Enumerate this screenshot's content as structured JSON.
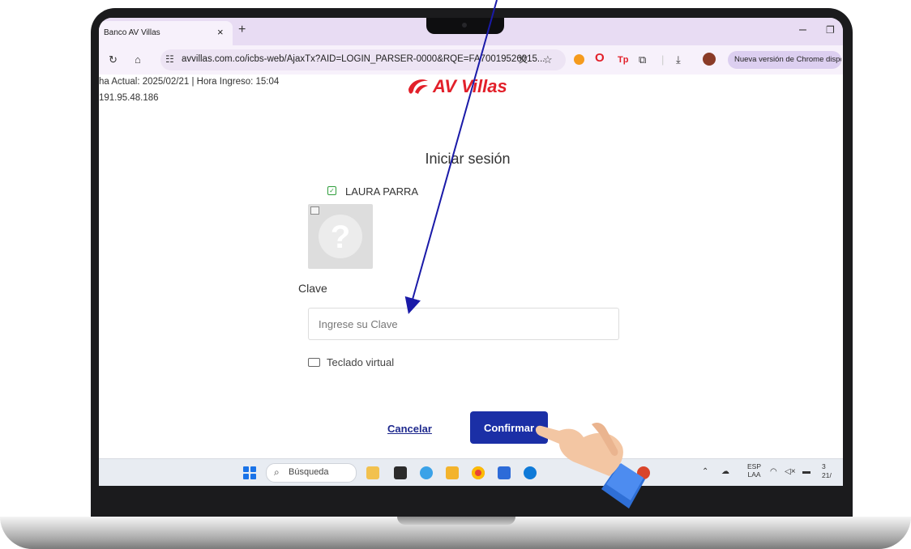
{
  "browser": {
    "tab_title": "Banco AV Villas",
    "tab_close": "×",
    "new_tab": "+",
    "minimize": "–",
    "restore": "❐",
    "url": "avvillas.com.co/icbs-web/AjaxTx?AID=LOGIN_PARSER-0000&RQE=FA70019526015...",
    "update_pill": "Nueva versión de Chrome disponible",
    "icons": [
      "reload-icon",
      "home-icon",
      "tune-icon",
      "translate-icon",
      "star-icon",
      "extension-icon",
      "opera-icon",
      "tp-icon",
      "puzzle-icon",
      "download-icon",
      "profile-avatar"
    ]
  },
  "page": {
    "date_line": "ha Actual: 2025/02/21 | Hora Ingreso: 15:04",
    "ip_line": "191.95.48.186",
    "brand": "AV Villas",
    "brand_color": "#e2202a",
    "title": "Iniciar sesión",
    "user_name": "LAURA PARRA",
    "password_label": "Clave",
    "password_placeholder": "Ingrese su Clave",
    "virtual_keyboard": "Teclado virtual",
    "cancel_label": "Cancelar",
    "confirm_label": "Confirmar",
    "confirm_color": "#1b2fa6",
    "image_placeholder_glyph": "?"
  },
  "taskbar": {
    "search_label": "Búsqueda",
    "lang_top": "ESP",
    "lang_bottom": "LAA",
    "clock_top": "3",
    "clock_bottom": "21/",
    "tray_icons": [
      "chevron-up-icon",
      "onedrive-icon",
      "wifi-icon",
      "volume-muted-icon",
      "battery-icon"
    ],
    "app_icons": [
      "file-explorer-icon",
      "terminal-icon",
      "copilot-icon",
      "folder-icon",
      "chrome-icon",
      "store-icon",
      "edge-icon",
      "powerpoint-icon"
    ]
  },
  "annotation": {
    "arrow_color": "#1a1aa8",
    "pointer": "hand-pointer-icon"
  }
}
